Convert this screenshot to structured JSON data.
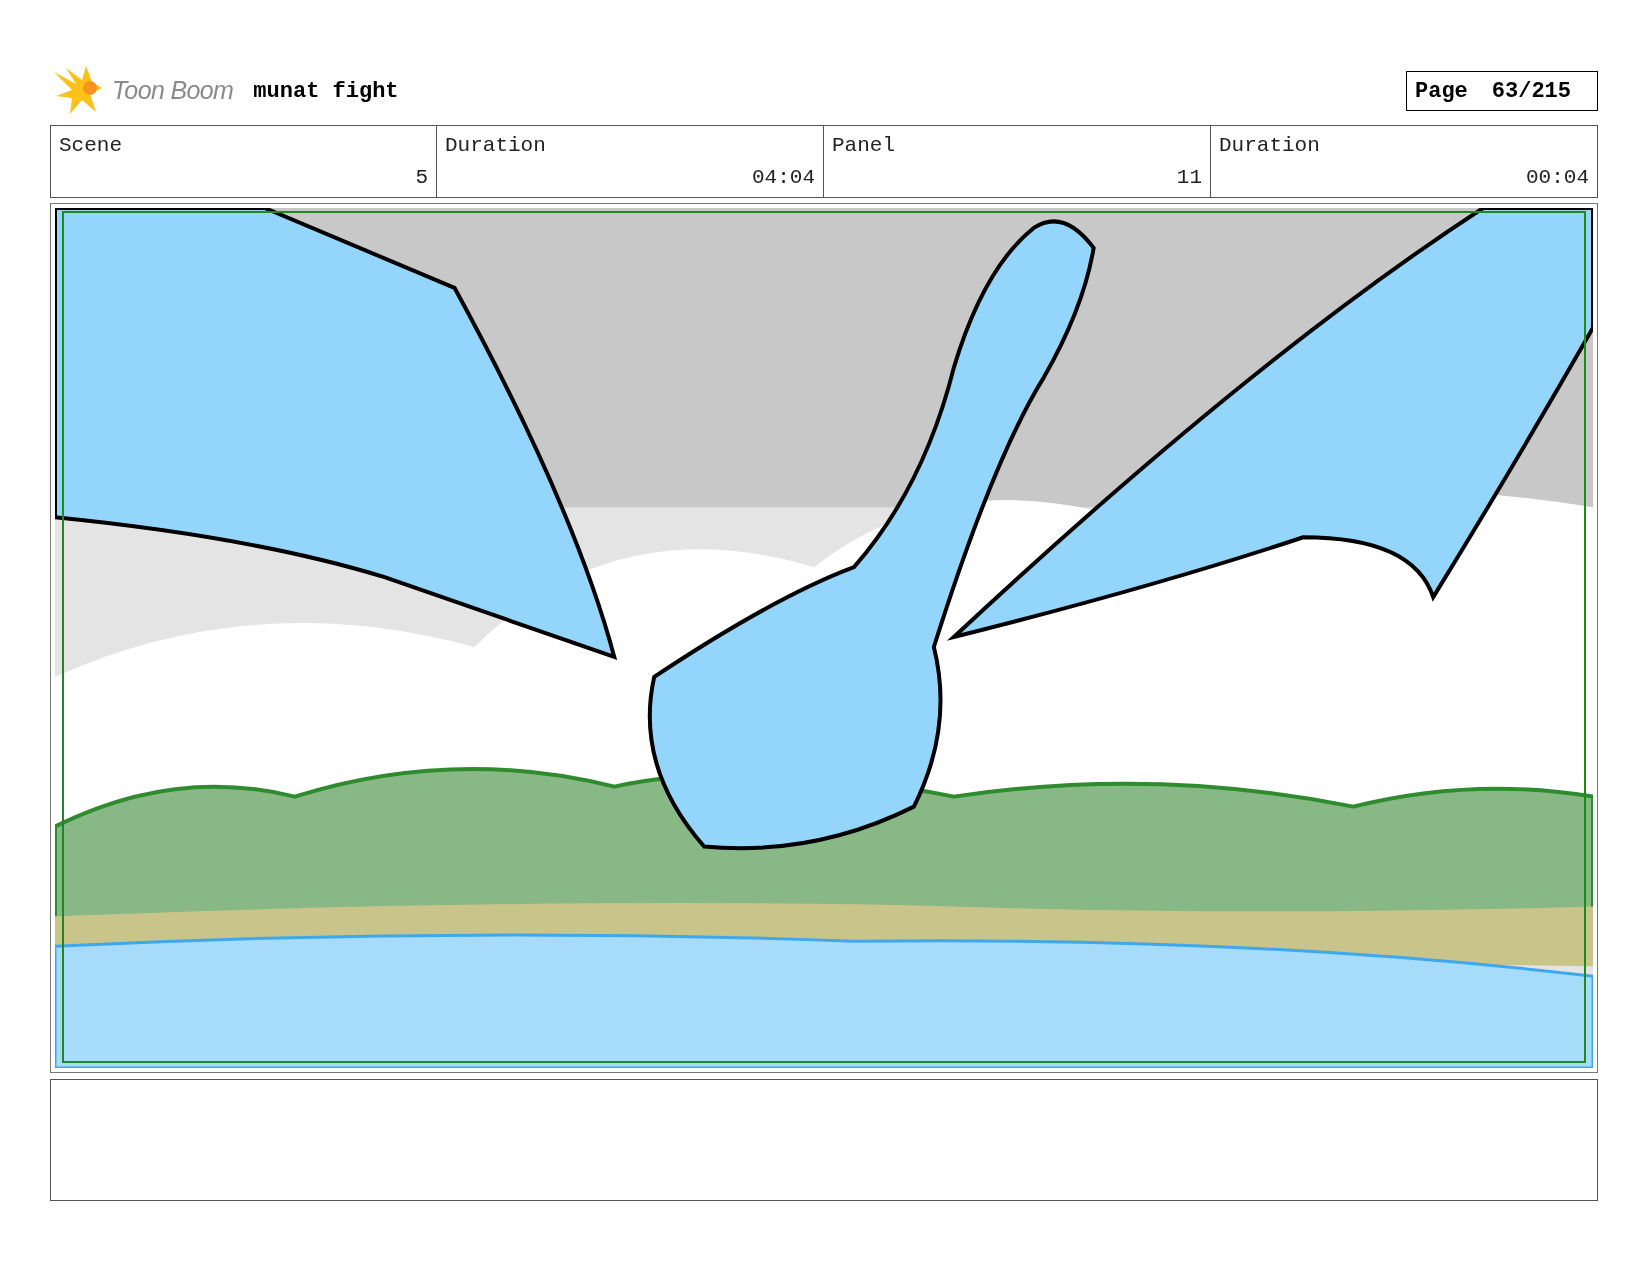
{
  "header": {
    "logo_text": "Toon Boom",
    "title": "munat fight",
    "page_label": "Page",
    "page_number": "63/215"
  },
  "info_table": {
    "columns": [
      "Scene",
      "Duration",
      "Panel",
      "Duration"
    ],
    "rows": [
      [
        "5",
        "04:04",
        "11",
        "00:04"
      ]
    ]
  }
}
